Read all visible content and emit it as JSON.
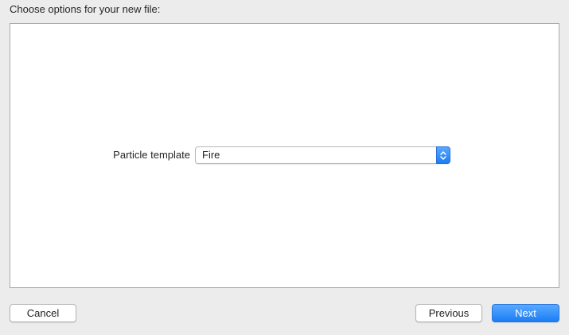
{
  "header": {
    "title": "Choose options for your new file:"
  },
  "form": {
    "particle_template": {
      "label": "Particle template",
      "selected": "Fire"
    }
  },
  "buttons": {
    "cancel": "Cancel",
    "previous": "Previous",
    "next": "Next"
  },
  "colors": {
    "accent": "#1a7ef5",
    "window_background": "#ececec",
    "panel_background": "#ffffff"
  }
}
